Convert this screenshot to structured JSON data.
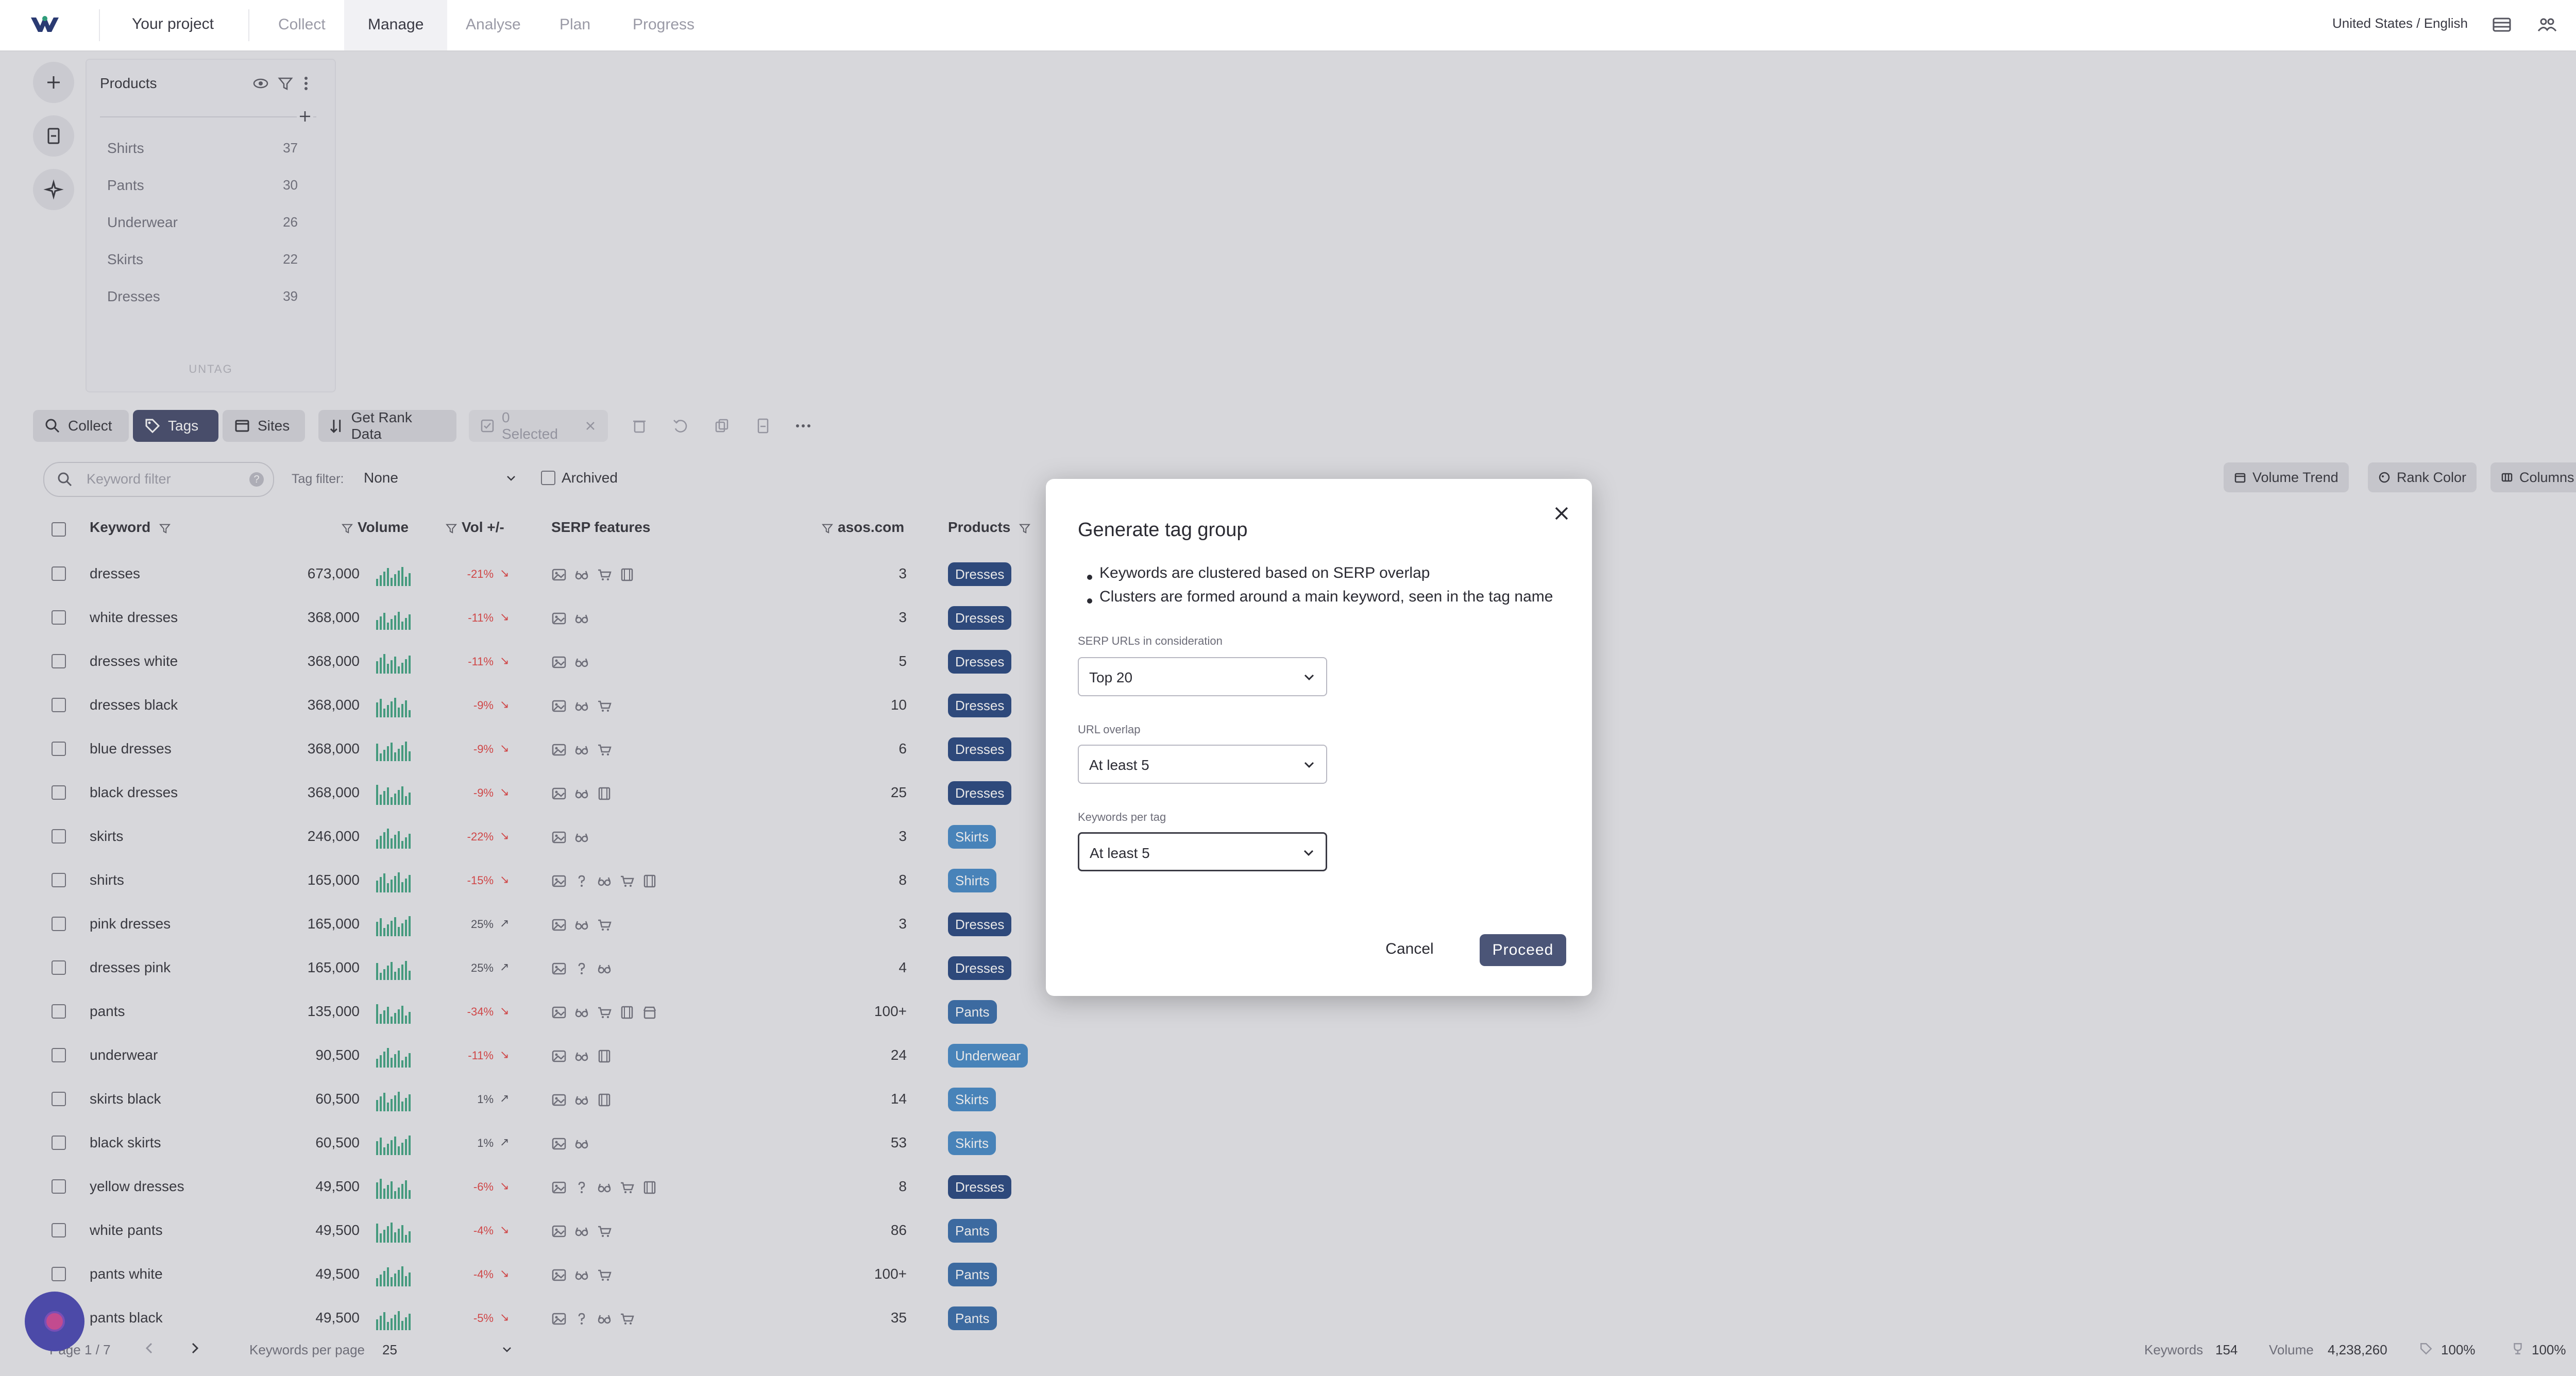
{
  "nav": {
    "project": "Your project",
    "tabs": [
      {
        "label": "Collect",
        "active": false
      },
      {
        "label": "Manage",
        "active": true
      },
      {
        "label": "Analyse",
        "active": false
      },
      {
        "label": "Plan",
        "active": false
      },
      {
        "label": "Progress",
        "active": false
      }
    ],
    "locale": "United States / English"
  },
  "tag_panel": {
    "title": "Products",
    "items": [
      {
        "label": "Shirts",
        "count": "37"
      },
      {
        "label": "Pants",
        "count": "30"
      },
      {
        "label": "Underwear",
        "count": "26"
      },
      {
        "label": "Skirts",
        "count": "22"
      },
      {
        "label": "Dresses",
        "count": "39"
      }
    ],
    "untag": "UNTAG"
  },
  "toolbar": {
    "collect": "Collect",
    "tags": "Tags",
    "sites": "Sites",
    "get_rank_data": "Get Rank Data",
    "selected": "0 Selected"
  },
  "filters": {
    "keyword_placeholder": "Keyword filter",
    "tag_filter_label": "Tag filter:",
    "tag_filter_value": "None",
    "archived": "Archived",
    "volume_trend": "Volume Trend",
    "rank_color": "Rank Color",
    "columns": "Columns"
  },
  "table": {
    "headers": {
      "keyword": "Keyword",
      "volume": "Volume",
      "vol_change": "Vol +/-",
      "serp": "SERP features",
      "site": "asos.com",
      "products": "Products"
    },
    "rows": [
      {
        "keyword": "dresses",
        "volume": "673,000",
        "change": "-21%",
        "dir": "down",
        "serp": [
          "image",
          "glasses",
          "cart",
          "film"
        ],
        "rank": "3",
        "tag": "Dresses"
      },
      {
        "keyword": "white dresses",
        "volume": "368,000",
        "change": "-11%",
        "dir": "down",
        "serp": [
          "image",
          "glasses"
        ],
        "rank": "3",
        "tag": "Dresses"
      },
      {
        "keyword": "dresses white",
        "volume": "368,000",
        "change": "-11%",
        "dir": "down",
        "serp": [
          "image",
          "glasses"
        ],
        "rank": "5",
        "tag": "Dresses"
      },
      {
        "keyword": "dresses black",
        "volume": "368,000",
        "change": "-9%",
        "dir": "down",
        "serp": [
          "image",
          "glasses",
          "cart"
        ],
        "rank": "10",
        "tag": "Dresses"
      },
      {
        "keyword": "blue dresses",
        "volume": "368,000",
        "change": "-9%",
        "dir": "down",
        "serp": [
          "image",
          "glasses",
          "cart"
        ],
        "rank": "6",
        "tag": "Dresses"
      },
      {
        "keyword": "black dresses",
        "volume": "368,000",
        "change": "-9%",
        "dir": "down",
        "serp": [
          "image",
          "glasses",
          "film"
        ],
        "rank": "25",
        "tag": "Dresses"
      },
      {
        "keyword": "skirts",
        "volume": "246,000",
        "change": "-22%",
        "dir": "down",
        "serp": [
          "image",
          "glasses"
        ],
        "rank": "3",
        "tag": "Skirts"
      },
      {
        "keyword": "shirts",
        "volume": "165,000",
        "change": "-15%",
        "dir": "down",
        "serp": [
          "image",
          "question",
          "glasses",
          "cart",
          "film"
        ],
        "rank": "8",
        "tag": "Shirts"
      },
      {
        "keyword": "pink dresses",
        "volume": "165,000",
        "change": "25%",
        "dir": "up",
        "serp": [
          "image",
          "glasses",
          "cart"
        ],
        "rank": "3",
        "tag": "Dresses"
      },
      {
        "keyword": "dresses pink",
        "volume": "165,000",
        "change": "25%",
        "dir": "up",
        "serp": [
          "image",
          "question",
          "glasses"
        ],
        "rank": "4",
        "tag": "Dresses"
      },
      {
        "keyword": "pants",
        "volume": "135,000",
        "change": "-34%",
        "dir": "down",
        "serp": [
          "image",
          "glasses",
          "cart",
          "film",
          "store"
        ],
        "rank": "100+",
        "tag": "Pants"
      },
      {
        "keyword": "underwear",
        "volume": "90,500",
        "change": "-11%",
        "dir": "down",
        "serp": [
          "image",
          "glasses",
          "film"
        ],
        "rank": "24",
        "tag": "Underwear"
      },
      {
        "keyword": "skirts black",
        "volume": "60,500",
        "change": "1%",
        "dir": "up",
        "serp": [
          "image",
          "glasses",
          "film"
        ],
        "rank": "14",
        "tag": "Skirts"
      },
      {
        "keyword": "black skirts",
        "volume": "60,500",
        "change": "1%",
        "dir": "up",
        "serp": [
          "image",
          "glasses"
        ],
        "rank": "53",
        "tag": "Skirts"
      },
      {
        "keyword": "yellow dresses",
        "volume": "49,500",
        "change": "-6%",
        "dir": "down",
        "serp": [
          "image",
          "question",
          "glasses",
          "cart",
          "film"
        ],
        "rank": "8",
        "tag": "Dresses"
      },
      {
        "keyword": "white pants",
        "volume": "49,500",
        "change": "-4%",
        "dir": "down",
        "serp": [
          "image",
          "glasses",
          "cart"
        ],
        "rank": "86",
        "tag": "Pants"
      },
      {
        "keyword": "pants white",
        "volume": "49,500",
        "change": "-4%",
        "dir": "down",
        "serp": [
          "image",
          "glasses",
          "cart"
        ],
        "rank": "100+",
        "tag": "Pants"
      },
      {
        "keyword": "pants black",
        "volume": "49,500",
        "change": "-5%",
        "dir": "down",
        "serp": [
          "image",
          "question",
          "glasses",
          "cart"
        ],
        "rank": "35",
        "tag": "Pants"
      }
    ],
    "tag_colors": {
      "Dresses": "#1e3f7a",
      "Skirts": "#3d86c6",
      "Shirts": "#3d86c6",
      "Pants": "#2f67a8",
      "Underwear": "#3d86c6"
    }
  },
  "footer": {
    "page": "Page 1 / 7",
    "per_page_label": "Keywords per page",
    "per_page_value": "25",
    "keywords_label": "Keywords",
    "keywords_value": "154",
    "volume_label": "Volume",
    "volume_value": "4,238,260",
    "pct1": "100%",
    "pct2": "100%"
  },
  "modal": {
    "title": "Generate tag group",
    "bullets": [
      "Keywords are clustered based on SERP overlap",
      "Clusters are formed around a main keyword, seen in the tag name"
    ],
    "fields": [
      {
        "label": "SERP URLs in consideration",
        "value": "Top 20"
      },
      {
        "label": "URL overlap",
        "value": "At least 5"
      },
      {
        "label": "Keywords per tag",
        "value": "At least 5"
      }
    ],
    "cancel": "Cancel",
    "proceed": "Proceed"
  },
  "colors": {
    "accent_dark": "#3d4466",
    "proceed": "#4b5577",
    "negative": "#e23b3b",
    "spark": "#3aa17e"
  }
}
